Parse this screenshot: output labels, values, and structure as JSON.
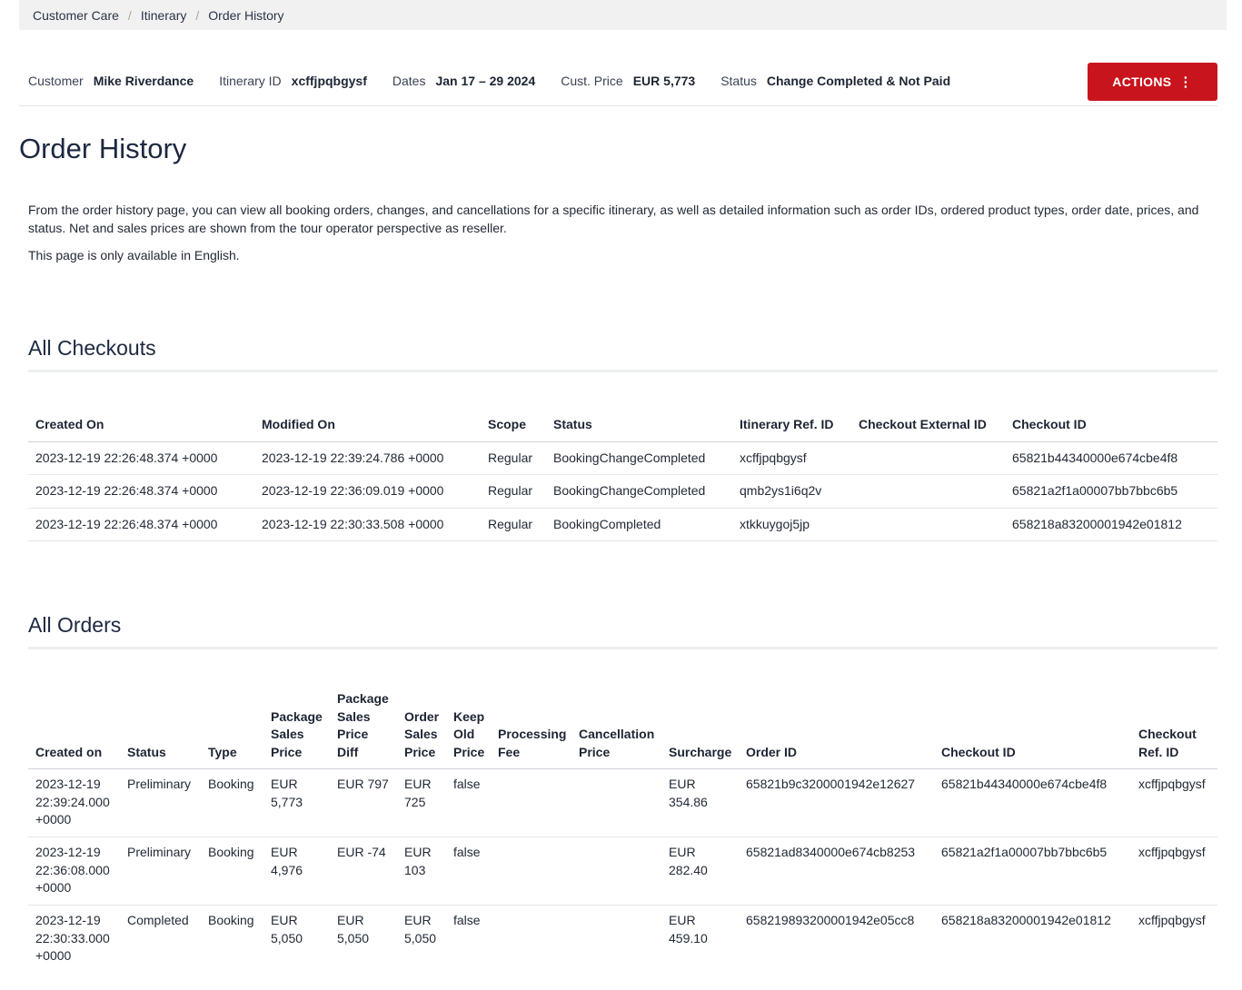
{
  "breadcrumb": {
    "items": [
      "Customer Care",
      "Itinerary",
      "Order History"
    ],
    "separator": "/"
  },
  "summary": {
    "customer_label": "Customer",
    "customer_value": "Mike Riverdance",
    "itinerary_label": "Itinerary ID",
    "itinerary_value": "xcffjpqbgysf",
    "dates_label": "Dates",
    "dates_value": "Jan 17 – 29 2024",
    "price_label": "Cust. Price",
    "price_value": "EUR 5,773",
    "status_label": "Status",
    "status_value": "Change Completed & Not Paid",
    "actions_label": "ACTIONS",
    "actions_icon": "kebab-menu-icon"
  },
  "page": {
    "title": "Order History",
    "intro_1": "From the order history page, you can view all booking orders, changes, and cancellations for a specific itinerary, as well as detailed information such as order IDs, ordered product types, order date, prices, and status. Net and sales prices are shown from the tour operator perspective as reseller.",
    "intro_2": "This page is only available in English."
  },
  "checkouts": {
    "title": "All Checkouts",
    "headers": [
      "Created On",
      "Modified On",
      "Scope",
      "Status",
      "Itinerary Ref. ID",
      "Checkout External ID",
      "Checkout ID"
    ],
    "rows": [
      [
        "2023-12-19 22:26:48.374 +0000",
        "2023-12-19 22:39:24.786 +0000",
        "Regular",
        "BookingChangeCompleted",
        "xcffjpqbgysf",
        "",
        "65821b44340000e674cbe4f8"
      ],
      [
        "2023-12-19 22:26:48.374 +0000",
        "2023-12-19 22:36:09.019 +0000",
        "Regular",
        "BookingChangeCompleted",
        "qmb2ys1i6q2v",
        "",
        "65821a2f1a00007bb7bbc6b5"
      ],
      [
        "2023-12-19 22:26:48.374 +0000",
        "2023-12-19 22:30:33.508 +0000",
        "Regular",
        "BookingCompleted",
        "xtkkuygoj5jp",
        "",
        "658218a83200001942e01812"
      ]
    ]
  },
  "orders": {
    "title": "All Orders",
    "headers": [
      "Created on",
      "Status",
      "Type",
      "Package Sales Price",
      "Package Sales Price Diff",
      "Order Sales Price",
      "Keep Old Price",
      "Processing Fee",
      "Cancellation Price",
      "Surcharge",
      "Order ID",
      "Checkout ID",
      "Checkout Ref. ID"
    ],
    "rows": [
      [
        "2023-12-19 22:39:24.000 +0000",
        "Preliminary",
        "Booking",
        "EUR 5,773",
        "EUR 797",
        "EUR 725",
        "false",
        "",
        "",
        "EUR 354.86",
        "65821b9c3200001942e12627",
        "65821b44340000e674cbe4f8",
        "xcffjpqbgysf"
      ],
      [
        "2023-12-19 22:36:08.000 +0000",
        "Preliminary",
        "Booking",
        "EUR 4,976",
        "EUR -74",
        "EUR 103",
        "false",
        "",
        "",
        "EUR 282.40",
        "65821ad8340000e674cb8253",
        "65821a2f1a00007bb7bbc6b5",
        "xcffjpqbgysf"
      ],
      [
        "2023-12-19 22:30:33.000 +0000",
        "Completed",
        "Booking",
        "EUR 5,050",
        "EUR 5,050",
        "EUR 5,050",
        "false",
        "",
        "",
        "EUR 459.10",
        "658219893200001942e05cc8",
        "658218a83200001942e01812",
        "xcffjpqbgysf"
      ]
    ]
  }
}
